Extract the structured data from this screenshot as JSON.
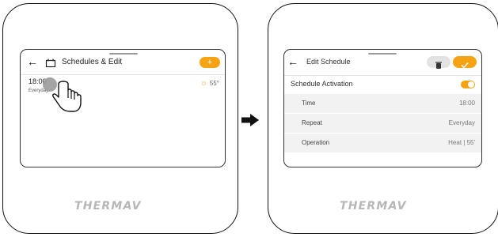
{
  "before": {
    "header": {
      "title": "Schedules & Edit",
      "add_label": "+"
    },
    "schedule_item": {
      "time": "18:00",
      "repeat": "Everyday",
      "temperature": "55°"
    },
    "brand": "THERMAV"
  },
  "after": {
    "header": {
      "title": "Edit Schedule"
    },
    "activation": {
      "label": "Schedule Activation",
      "enabled": true
    },
    "rows": [
      {
        "label": "Time",
        "value": "18:00"
      },
      {
        "label": "Repeat",
        "value": "Everyday"
      },
      {
        "label": "Operation",
        "value": "Heat | 55'"
      }
    ],
    "brand": "THERMAV"
  },
  "colors": {
    "accent": "#f6a313",
    "row_bg": "#f2f2f2",
    "brand": "#b7b7b7"
  },
  "icons": [
    "back-arrow-icon",
    "schedule-icon",
    "plus-icon",
    "sun-icon",
    "hand-pointer-icon",
    "next-arrow-icon",
    "trash-icon",
    "check-icon",
    "toggle-icon"
  ]
}
